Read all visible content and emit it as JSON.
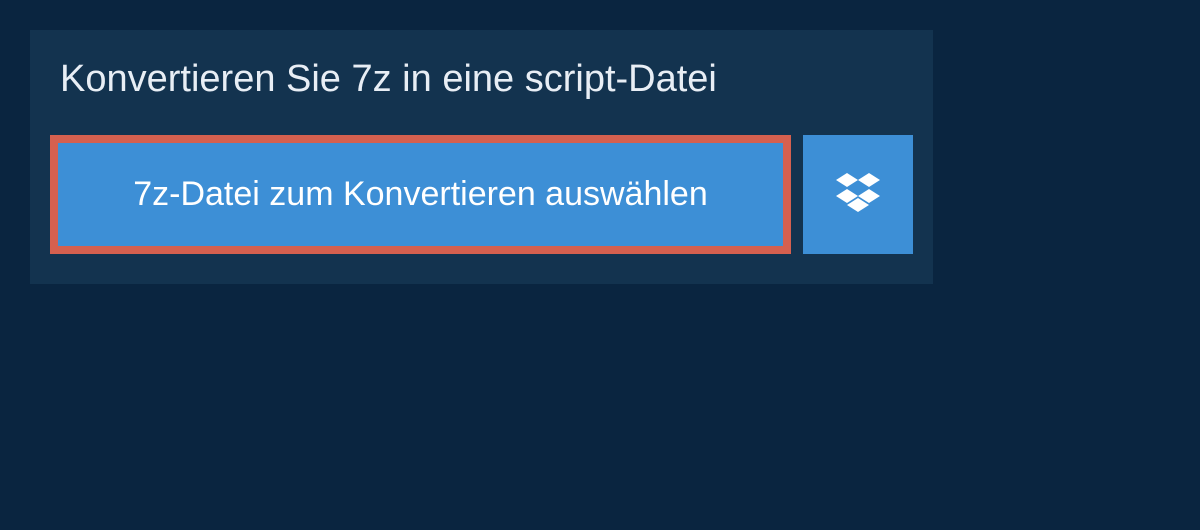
{
  "panel": {
    "heading": "Konvertieren Sie 7z in eine script-Datei",
    "selectFileButton": "7z-Datei zum Konvertieren auswählen"
  },
  "colors": {
    "pageBg": "#0a2540",
    "panelBg": "#13334f",
    "buttonBg": "#3d8fd6",
    "buttonHighlight": "#d5604f",
    "textLight": "#e8eef5",
    "textWhite": "#ffffff"
  }
}
